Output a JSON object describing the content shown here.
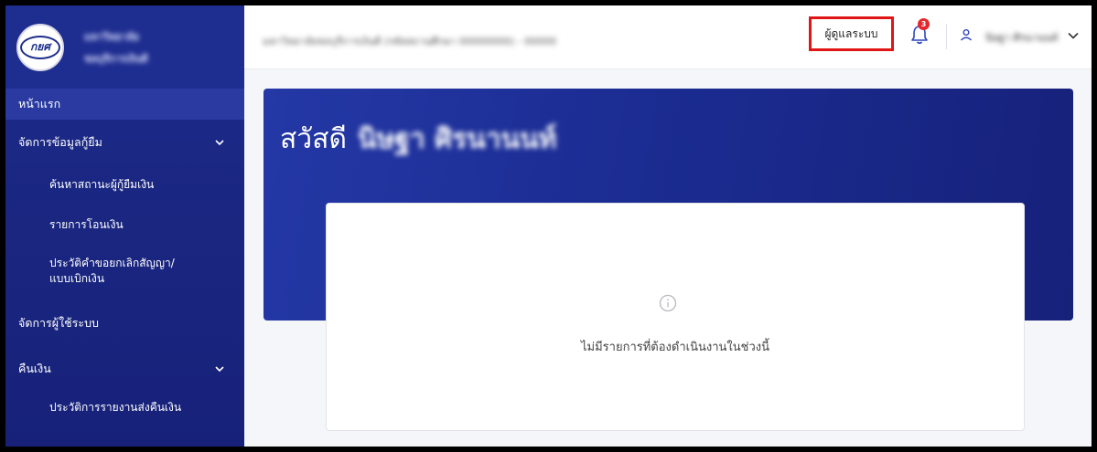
{
  "brand": {
    "line1": "มหาวิทยาลัย",
    "line2": "ชลบุรีการเงินดี",
    "logo_text": "กยศ"
  },
  "sidebar": {
    "items": [
      {
        "label": "หน้าแรก"
      },
      {
        "label": "จัดการข้อมูลกู้ยืม"
      },
      {
        "label": "ค้นหาสถานะผู้กู้ยืมเงิน"
      },
      {
        "label": "รายการโอนเงิน"
      },
      {
        "label": "ประวัติคำขอยกเลิกสัญญา/"
      },
      {
        "label": "แบบเบิกเงิน"
      },
      {
        "label": "จัดการผู้ใช้ระบบ"
      },
      {
        "label": "คืนเงิน"
      },
      {
        "label": "ประวัติการรายงานส่งคืนเงิน"
      }
    ]
  },
  "topbar": {
    "org_name": "มหาวิทยาลัยชลบุรีการเงินดี (รหัสสถานศึกษา 00000000) - 00000",
    "admin_label": "ผู้ดูแลระบบ",
    "notification_count": "3",
    "user_name": "นิษฐา ศิรนานนท์"
  },
  "hero": {
    "greeting": "สวัสดี",
    "name": "นิษฐา ศิรนานนท์"
  },
  "empty_state": {
    "message": "ไม่มีรายการที่ต้องดำเนินงานในช่วงนี้"
  },
  "colors": {
    "sidebar": "#1d2c8c",
    "accent": "#2438a6",
    "highlight": "#e11515",
    "badge": "#e5262c"
  }
}
